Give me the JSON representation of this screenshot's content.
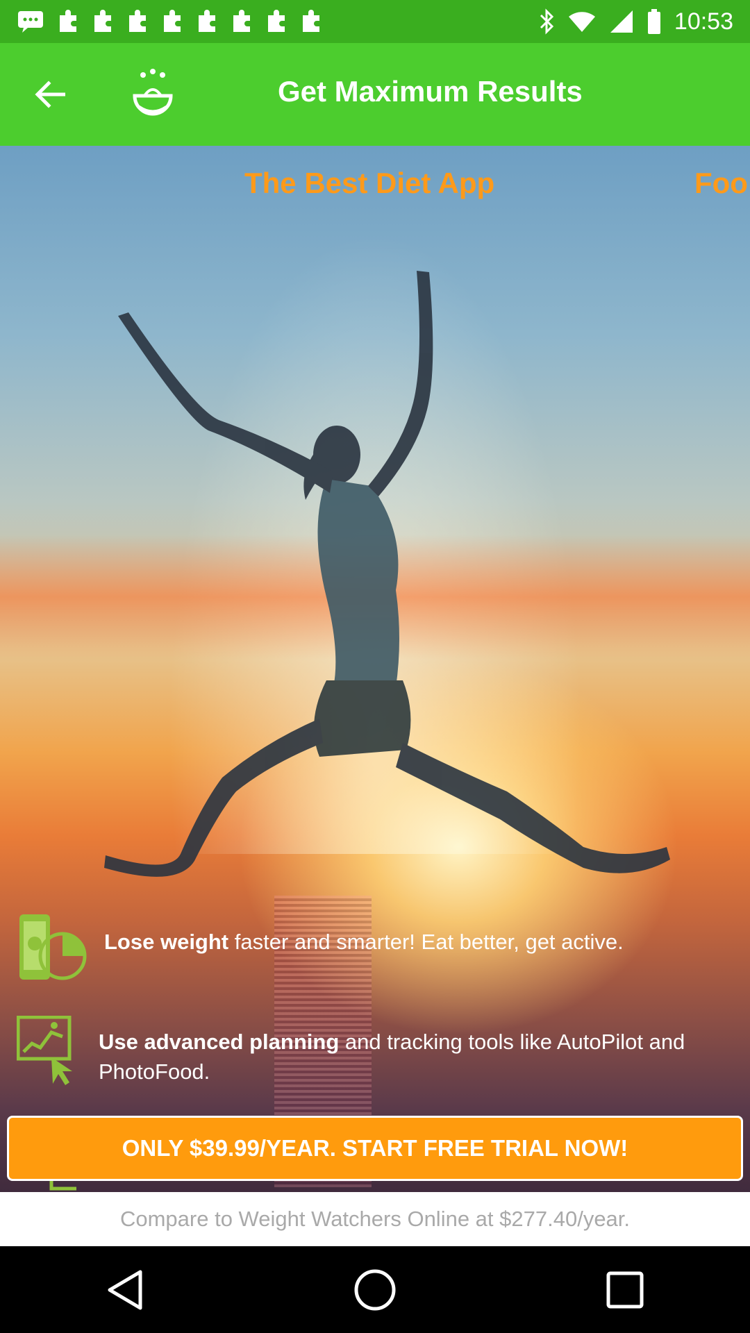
{
  "status_bar": {
    "time": "10:53",
    "left_icons": [
      "chat-icon",
      "puzzle-icon",
      "puzzle-icon",
      "puzzle-icon",
      "puzzle-icon",
      "puzzle-icon",
      "puzzle-icon",
      "puzzle-icon",
      "puzzle-icon"
    ],
    "right_icons": [
      "bluetooth-icon",
      "wifi-icon",
      "signal-icon",
      "battery-icon"
    ]
  },
  "app_bar": {
    "title": "Get Maximum Results",
    "back_icon": "back-arrow-icon",
    "logo_icon": "app-logo-icon"
  },
  "carousel": {
    "current_title": "The Best Diet App",
    "next_title_peek": "Foo"
  },
  "features": [
    {
      "bold": "Lose weight",
      "rest": " faster and smarter! Eat better, get active.",
      "icon": "phone-pie-chart-icon"
    },
    {
      "bold": "Use advanced planning",
      "rest": " and tracking tools like AutoPilot and PhotoFood.",
      "icon": "planning-runner-icon"
    }
  ],
  "cta": {
    "label": "ONLY $39.99/YEAR. START FREE TRIAL NOW!"
  },
  "compare": {
    "text": "Compare to Weight Watchers Online at $277.40/year."
  },
  "colors": {
    "status_bar": "#3aae1f",
    "app_bar": "#4ccd2e",
    "accent_orange": "#ff9b0d",
    "slide_title": "#ff9a1a"
  },
  "nav_bar": {
    "buttons": [
      "back-triangle-icon",
      "home-circle-icon",
      "recents-square-icon"
    ]
  }
}
